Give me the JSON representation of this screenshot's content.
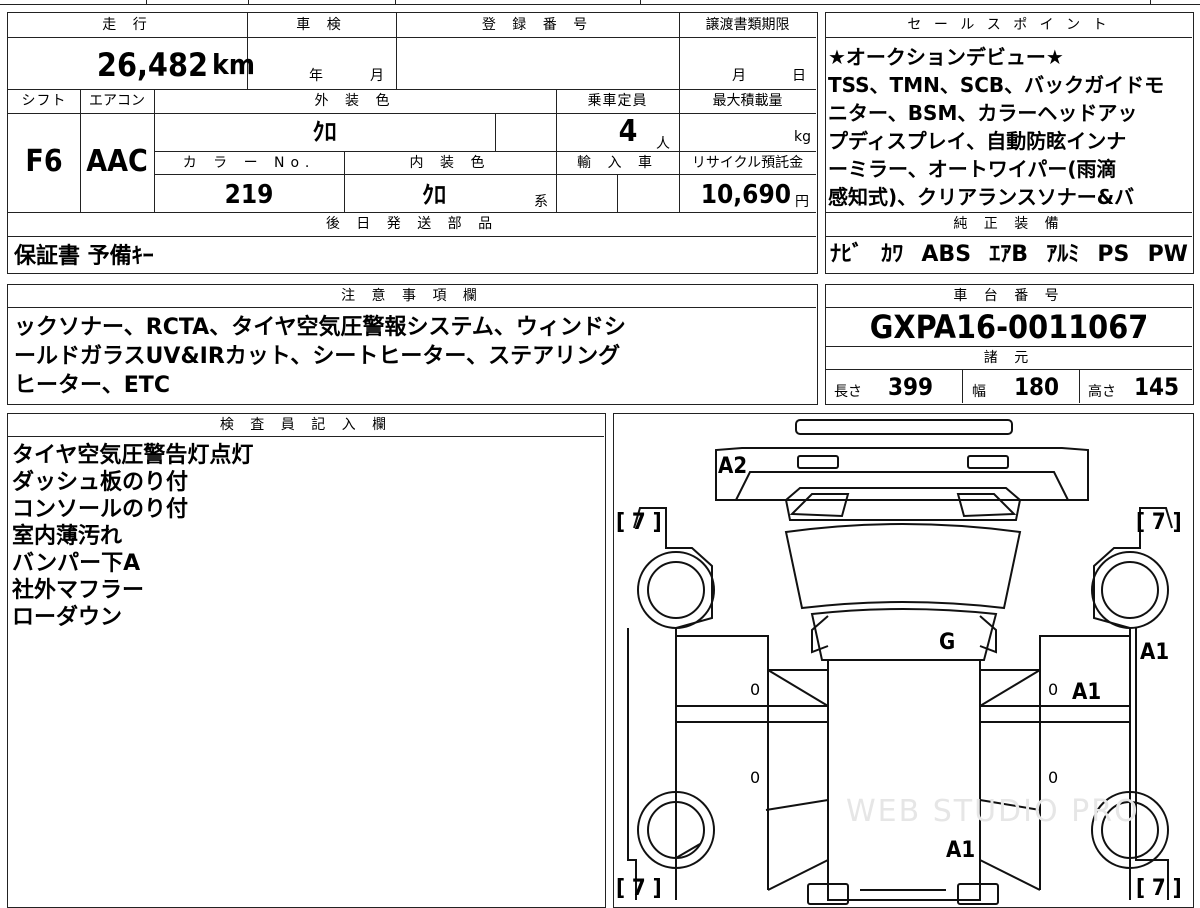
{
  "top": {
    "mileage_header": "走 行",
    "shaken_header": "車 検",
    "reg_header": "登 録 番 号",
    "transfer_header": "譲渡書類期限",
    "mileage_value": "26,482",
    "mileage_unit": "km",
    "shaken_year": "年",
    "shaken_month": "月",
    "transfer_month": "月",
    "transfer_day": "日"
  },
  "row2": {
    "shift_header": "シフト",
    "ac_header": "エアコン",
    "exterior_header": "外 装 色",
    "capacity_header": "乗車定員",
    "load_header": "最大積載量",
    "shift_value": "F6",
    "ac_value": "AAC",
    "exterior_value": "ｸﾛ",
    "capacity_value": "4",
    "capacity_unit": "人",
    "load_unit": "kg"
  },
  "row3": {
    "color_no_header": "カ ラ ー No.",
    "interior_header": "内 装 色",
    "import_header": "輸 入 車",
    "recycle_header": "リサイクル預託金",
    "color_no_value": "219",
    "interior_value": "ｸﾛ",
    "interior_suffix": "系",
    "recycle_value": "10,690",
    "recycle_unit": "円"
  },
  "later_parts": {
    "header": "後 日 発 送 部 品",
    "value": "保証書  予備ｷｰ"
  },
  "sales": {
    "header": "セ ー ル ス ポ イ ン ト",
    "lines": [
      "★オークションデビュー★",
      "TSS、TMN、SCB、バックガイドモ",
      "ニター、BSM、カラーヘッドアッ",
      "プディスプレイ、自動防眩インナ",
      "ーミラー、オートワイパー(雨滴",
      "感知式)、クリアランスソナー&バ"
    ]
  },
  "equipment": {
    "header": "純 正 装 備",
    "items": [
      "ﾅﾋﾞ",
      "ｶﾜ",
      "ABS",
      "ｴｱB",
      "ｱﾙﾐ",
      "PS",
      "PW"
    ]
  },
  "notes": {
    "header": "注 意 事 項 欄",
    "lines": [
      "ックソナー、RCTA、タイヤ空気圧警報システム、ウィンドシ",
      "ールドガラスUV&IRカット、シートヒーター、ステアリング",
      "ヒーター、ETC"
    ]
  },
  "chassis": {
    "header": "車 台 番 号",
    "value": "GXPA16-0011067"
  },
  "specs": {
    "header": "諸 元",
    "length_label": "長さ",
    "length_value": "399",
    "width_label": "幅",
    "width_value": "180",
    "height_label": "高さ",
    "height_value": "145"
  },
  "inspector": {
    "header": "検 査 員 記 入 欄",
    "lines": [
      "タイヤ空気圧警告灯点灯",
      "ダッシュ板のり付",
      "コンソールのり付",
      "室内薄汚れ",
      "バンパー下A",
      "社外マフラー",
      "ローダウン"
    ]
  },
  "diagram": {
    "tire_marks": [
      "[ 7 ]",
      "[ 7 ]",
      "[ 7 ]",
      "[ 7 ]"
    ],
    "mark_a2": "A2",
    "mark_g": "G",
    "mark_a1_side": "A1",
    "mark_a1_door": "A1",
    "mark_a1_rear": "A1",
    "door_marks": [
      "0",
      "0",
      "0",
      "0"
    ],
    "watermark": "WEB STUDIO PRO"
  }
}
